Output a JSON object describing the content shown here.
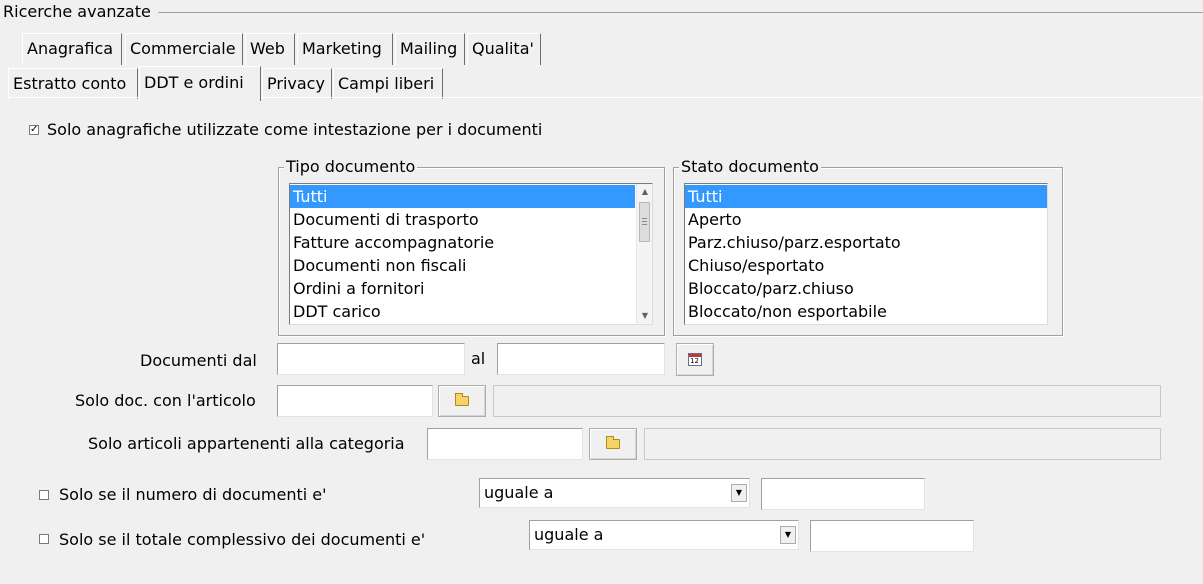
{
  "group": {
    "title": "Ricerche avanzate"
  },
  "tabs_row1": [
    {
      "label": "Anagrafica"
    },
    {
      "label": "Commerciale"
    },
    {
      "label": "Web"
    },
    {
      "label": "Marketing"
    },
    {
      "label": "Mailing"
    },
    {
      "label": "Qualita'"
    }
  ],
  "tabs_row2": [
    {
      "label": "Estratto conto"
    },
    {
      "label": "DDT e ordini",
      "active": true
    },
    {
      "label": "Privacy"
    },
    {
      "label": "Campi liberi"
    }
  ],
  "solo_anagrafiche": {
    "label": "Solo anagrafiche utilizzate come intestazione per i documenti",
    "checked": true
  },
  "tipo_documento": {
    "title": "Tipo documento",
    "items": [
      "Tutti",
      "Documenti di trasporto",
      "Fatture accompagnatorie",
      "Documenti non fiscali",
      "Ordini a fornitori",
      "DDT carico"
    ],
    "selected": "Tutti"
  },
  "stato_documento": {
    "title": "Stato documento",
    "items": [
      "Tutti",
      "Aperto",
      "Parz.chiuso/parz.esportato",
      "Chiuso/esportato",
      "Bloccato/parz.chiuso",
      "Bloccato/non esportabile"
    ],
    "selected": "Tutti"
  },
  "documenti_dal": {
    "label": "Documenti dal",
    "from_value": "",
    "to_label": "al",
    "to_value": "",
    "calendar_icon": "calendar-icon",
    "calendar_text": "12"
  },
  "solo_articolo": {
    "label": "Solo doc. con l'articolo",
    "value": "",
    "description": "",
    "browse_icon": "folder-icon"
  },
  "solo_categoria": {
    "label": "Solo articoli appartenenti alla categoria",
    "value": "",
    "description": "",
    "browse_icon": "folder-icon"
  },
  "numero_documenti": {
    "label": "Solo se il numero di documenti e'",
    "checked": false,
    "operator": "uguale a",
    "value": ""
  },
  "totale_documenti": {
    "label": "Solo se il totale complessivo dei documenti e'",
    "checked": false,
    "operator": "uguale a",
    "value": ""
  },
  "colors": {
    "selection": "#3399ff",
    "background": "#f0f0f0"
  }
}
